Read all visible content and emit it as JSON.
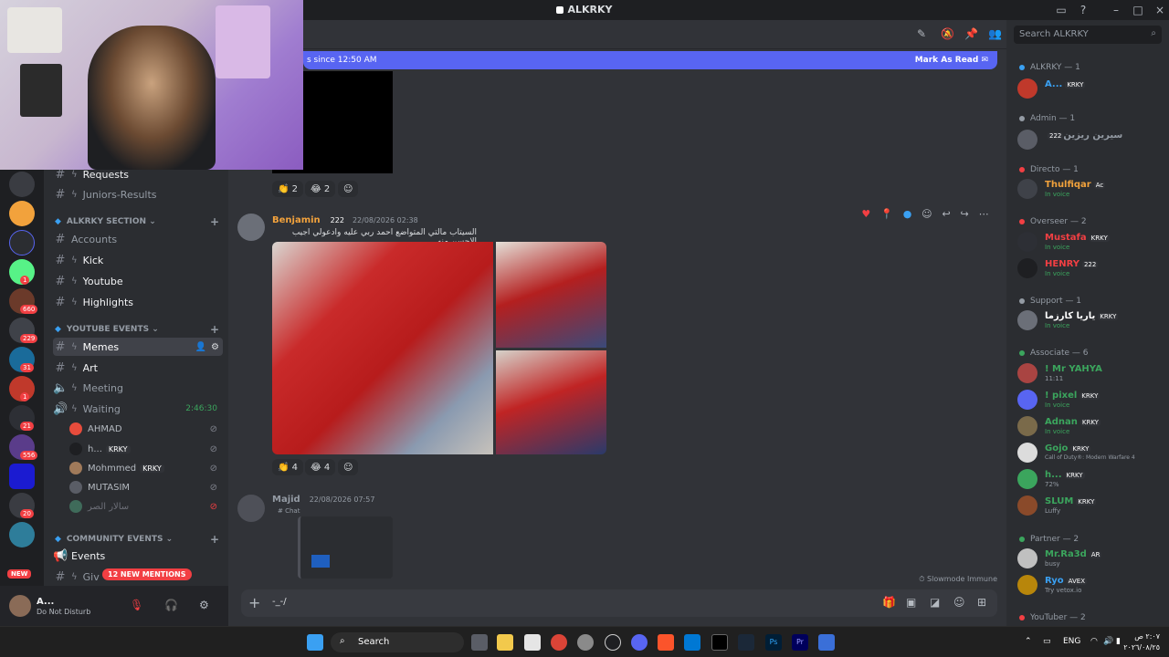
{
  "window": {
    "title": "ALKRKY"
  },
  "new_messages_bar": {
    "since": "s since 12:50 AM",
    "mark_read": "Mark As Read"
  },
  "top_message": {
    "reactions": [
      {
        "emoji": "👏",
        "count": "2"
      },
      {
        "emoji": "😂",
        "count": "2"
      }
    ]
  },
  "channels": {
    "top": [
      {
        "name": "Requests"
      },
      {
        "name": "Juniors-Results"
      }
    ],
    "alkrky_section": {
      "label": "ALKRKY SECTION",
      "items": [
        "Accounts",
        "Kick",
        "Youtube",
        "Highlights"
      ]
    },
    "youtube_events": {
      "label": "YOUTUBE EVENTS",
      "items": [
        "Memes",
        "Art",
        "Meeting",
        "Waiting"
      ]
    },
    "waiting_timer": "2:46:30",
    "voice_users": [
      {
        "name": "AHMAD",
        "tag": ""
      },
      {
        "name": "h...",
        "tag": "KRKY"
      },
      {
        "name": "Mohmmed",
        "tag": "KRKY"
      },
      {
        "name": "MUTASIM",
        "tag": ""
      },
      {
        "name": "سالار الصر",
        "tag": ""
      }
    ],
    "community_events": {
      "label": "COMMUNITY EVENTS",
      "items": [
        "Events",
        "Giv"
      ]
    },
    "new_mentions": "12 NEW MENTIONS",
    "new_pill": "NEW"
  },
  "server_badges": [
    "1",
    "660",
    "229",
    "31",
    "1",
    "21",
    "556",
    "20"
  ],
  "user_panel": {
    "name": "A...",
    "status": "Do Not Disturb"
  },
  "message_benjamin": {
    "username": "Benjamin",
    "tag": "222",
    "timestamp": "22/08/2026 02:38",
    "text": "السيتاب مالتي المتواضع احمد ربي عليه وادعولي اجيب الاحسن منه",
    "reactions": [
      {
        "emoji": "👏",
        "count": "4"
      },
      {
        "emoji": "😂",
        "count": "4"
      }
    ]
  },
  "message_majid": {
    "username": "Majid",
    "timestamp": "22/08/2026 07:57",
    "reply_channel": "Chat"
  },
  "composer": {
    "value": "-_-/"
  },
  "slowmode": "Slowmode Immune",
  "search": {
    "placeholder": "Search ALKRKY"
  },
  "members": {
    "roles": [
      {
        "label": "ALKRKY — 1",
        "color": "#3aa0f2"
      },
      {
        "label": "Admin — 1",
        "color": "#949ba4"
      },
      {
        "label": "Directo — 1",
        "color": "#f23f43"
      },
      {
        "label": "Overseer — 2",
        "color": "#f23f43"
      },
      {
        "label": "Support — 1",
        "color": "#949ba4"
      },
      {
        "label": "Associate — 6",
        "color": "#3ba55d"
      },
      {
        "label": "Partner — 2",
        "color": "#3ba55d"
      },
      {
        "label": "YouTuber — 2",
        "color": "#f23f43"
      }
    ],
    "list": [
      {
        "name": "A...",
        "tag": "KRKY",
        "sub": "",
        "color": "#3aa0f2"
      },
      {
        "name": "سيرين ريزين",
        "tag": "222",
        "sub": "",
        "color": "#949ba4"
      },
      {
        "name": "Thulfiqar",
        "tag": "Ac",
        "sub": "In voice",
        "color": "#f2a23c"
      },
      {
        "name": "Mustafa",
        "tag": "KRKY",
        "sub": "In voice",
        "color": "#f23f43"
      },
      {
        "name": "HENRY",
        "tag": "222",
        "sub": "In voice",
        "color": "#f23f43"
      },
      {
        "name": "ياريا كارزما",
        "tag": "KRKY",
        "sub": "In voice",
        "color": "#ffffff"
      },
      {
        "name": "! Mr YAHYA",
        "tag": "",
        "sub": "11:11",
        "color": "#3ba55d"
      },
      {
        "name": "! pixel",
        "tag": "KRKY",
        "sub": "In voice",
        "color": "#3ba55d"
      },
      {
        "name": "Adnan",
        "tag": "KRKY",
        "sub": "In voice",
        "color": "#3ba55d"
      },
      {
        "name": "Gojo",
        "tag": "KRKY",
        "sub": "Call of Duty®: Modern Warfare 4",
        "color": "#3ba55d"
      },
      {
        "name": "h...",
        "tag": "KRKY",
        "sub": "72%",
        "color": "#3ba55d"
      },
      {
        "name": "SLUM",
        "tag": "KRKY",
        "sub": "Luffy",
        "color": "#3ba55d"
      },
      {
        "name": "Mr.Ra3d",
        "tag": "AR",
        "sub": "busy",
        "color": "#3ba55d"
      },
      {
        "name": "Ryo",
        "tag": "AVEX",
        "sub": "Try vetox.io",
        "color": "#3ba55d"
      }
    ]
  },
  "taskbar": {
    "search": "Search",
    "lang": "ENG",
    "time": "٢:٠٧ ص",
    "date": "٢٠٢٦/٠٨/٢٥"
  },
  "colors": {
    "accent": "#5865f2",
    "mention_red": "#f23f43",
    "online_green": "#3ba55d"
  }
}
